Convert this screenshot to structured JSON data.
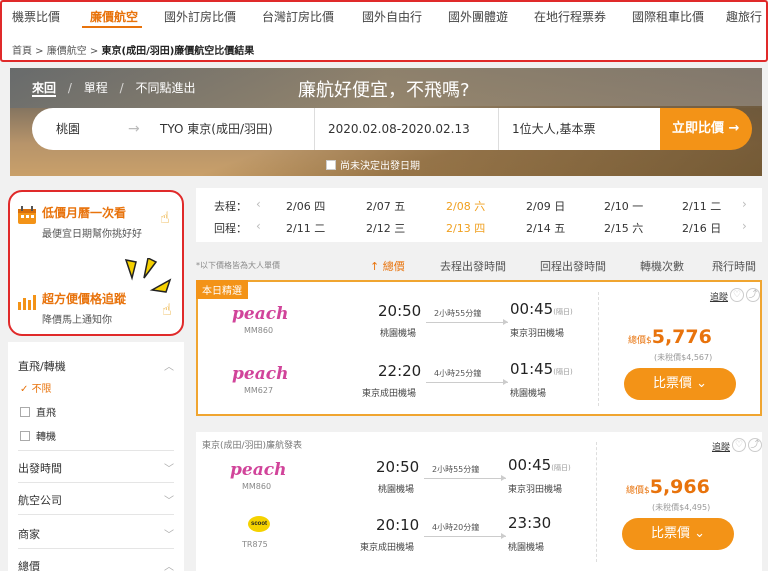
{
  "nav": {
    "tabs": [
      "機票比價",
      "廉價航空",
      "國外訂房比價",
      "台灣訂房比價",
      "國外自由行",
      "國外團體遊",
      "在地行程票券",
      "國際租車比價",
      "趣旅行"
    ],
    "active_tab": "廉價航空",
    "breadcrumb": [
      "首頁",
      "廉價航空",
      "東京(成田/羽田)廉價航空比價結果"
    ]
  },
  "hero": {
    "trip_types": [
      "來回",
      "單程",
      "不同點進出"
    ],
    "separator": "/",
    "slogan": "廉航好便宜，不飛嗎?",
    "from": "桃園",
    "arrow": "→",
    "to": "TYO 東京(成田/羽田)",
    "dates": "2020.02.08-2020.02.13",
    "passengers": "1位大人,基本票",
    "compare_button": "立即比價",
    "compare_arrow": "→",
    "undecided_label": "尚未決定出發日期"
  },
  "promo": {
    "item1_title": "低價月曆一次看",
    "item1_sub": "最便宜日期幫你挑好好",
    "item2_title": "超方便價格追蹤",
    "item2_sub": "降價馬上通知你"
  },
  "filters": {
    "stops_label": "直飛/轉機",
    "opt_any": "不限",
    "opt_direct": "直飛",
    "opt_transfer": "轉機",
    "departure_time": "出發時間",
    "airline": "航空公司",
    "merchant": "商家",
    "total_price": "總價"
  },
  "dates": {
    "outbound_label": "去程：",
    "return_label": "回程：",
    "outbound": [
      "2/06 四",
      "2/07 五",
      "2/08 六",
      "2/09 日",
      "2/10 一",
      "2/11 二"
    ],
    "return": [
      "2/11 二",
      "2/12 三",
      "2/13 四",
      "2/14 五",
      "2/15 六",
      "2/16 日"
    ],
    "selected_out": "2/08 六",
    "selected_ret": "2/13 四"
  },
  "sort": {
    "note": "*以下價格皆為大人單價",
    "options": [
      "總價",
      "去程出發時間",
      "回程出發時間",
      "轉機次數",
      "飛行時間"
    ],
    "selected": "總價",
    "selected_arrow": "↑"
  },
  "cards": [
    {
      "ribbon": "本日精選",
      "source": "",
      "follow": "追蹤",
      "segments": [
        {
          "airline": "peach",
          "flight": "MM860",
          "dep": "20:50",
          "dep_apt": "桃園機場",
          "duration": "2小時55分鐘",
          "arr": "00:45",
          "arr_next": "(隔日)",
          "arr_apt": "東京羽田機場"
        },
        {
          "airline": "peach",
          "flight": "MM627",
          "dep": "22:20",
          "dep_apt": "東京成田機場",
          "duration": "4小時25分鐘",
          "arr": "01:45",
          "arr_next": "(隔日)",
          "arr_apt": "桃園機場"
        }
      ],
      "price_prefix": "總價$",
      "price": "5,776",
      "tax_note": "(未稅價$4,567)",
      "button": "比票價"
    },
    {
      "ribbon": "",
      "source": "東京(成田/羽田)廉航發表",
      "follow": "追蹤",
      "segments": [
        {
          "airline": "peach",
          "flight": "MM860",
          "dep": "20:50",
          "dep_apt": "桃園機場",
          "duration": "2小時55分鐘",
          "arr": "00:45",
          "arr_next": "(隔日)",
          "arr_apt": "東京羽田機場"
        },
        {
          "airline": "scoot",
          "flight": "TR875",
          "dep": "20:10",
          "dep_apt": "東京成田機場",
          "duration": "4小時20分鐘",
          "arr": "23:30",
          "arr_next": "",
          "arr_apt": "桃園機場"
        }
      ],
      "price_prefix": "總價$",
      "price": "5,966",
      "tax_note": "(未稅價$4,495)",
      "button": "比票價"
    }
  ],
  "colors": {
    "accent": "#f39317",
    "brand_orange": "#e8730c",
    "highlight_red": "#e02a2a",
    "peach_pink": "#d1449a"
  }
}
